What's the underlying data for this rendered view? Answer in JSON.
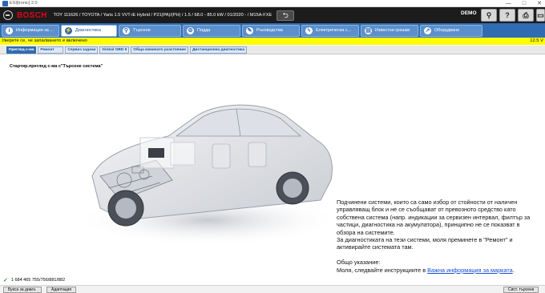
{
  "window": {
    "title": "ESI[tronic] 2.0",
    "controls": [
      "—",
      "□",
      "✕"
    ]
  },
  "header": {
    "brand": "BOSCH",
    "vehicle": "TOY 111626 / TOYOTA / Yaris 1.5 VVT-iE Hybrid / P21(PA)/(PH) / 1.5 / 68.0 - 85.0 kW / 01/2020 - / M15A-FXE",
    "back": "⮌",
    "demo": "DEMO",
    "buttons": [
      "⚲",
      "?",
      "⎙",
      "▭"
    ]
  },
  "tabs": [
    {
      "icon": "i",
      "label": "Информация за ..."
    },
    {
      "icon": "⚡",
      "label": "Диагностика"
    },
    {
      "icon": "⚲",
      "label": "Търсене"
    },
    {
      "icon": "⚙",
      "label": "Подда"
    },
    {
      "icon": "✎",
      "label": "Ръководства"
    },
    {
      "icon": "ϟ",
      "label": "Електрическа с..."
    },
    {
      "icon": "▤",
      "label": "Известни грешки"
    },
    {
      "icon": "↗",
      "label": "Оборудване"
    }
  ],
  "warning": {
    "text": "Уверете се, че запалването е включено",
    "voltage": "12.5 V"
  },
  "subtabs": [
    "Преглед с-ма",
    "Ремонт",
    "Сервиз задачи",
    "Global OBD II",
    "Обща изминато разстояние",
    "Дистанционна диагностика"
  ],
  "content": {
    "title": "Стартир.преглед с-ма с\"Търсене система\"",
    "info_p1": "Подчинени системи, които са само избор от стойности от наличен управляващ блок и не се съобщават от превозното средство като собствена система (напр. индикации за сервизен интервал, филтър за частици, диагностика на акумулатора), принципно не се показват в обзора на системите.",
    "info_p2": "За диагностиката на тези системи, моля преминете в \"Ремонт\" и активирайте системата там.",
    "info_p3_label": "Общо указание:",
    "info_p3_text": "Моля, следвайте инструкциите в ",
    "info_link": "Важна информация за марката",
    "info_end": "."
  },
  "status": {
    "check": "✓",
    "text": "1 684 465 755/756/881/882"
  },
  "footer": {
    "left1": "Букса за диагн.",
    "left2": "Адаптация",
    "right": "Сист. търсене"
  },
  "colors": {
    "header_bg": "#1c1c1c",
    "brand": "#e4001c",
    "tab_bar": "#2f6cb2",
    "warning": "#ffff00",
    "link": "#1a4fd6"
  }
}
